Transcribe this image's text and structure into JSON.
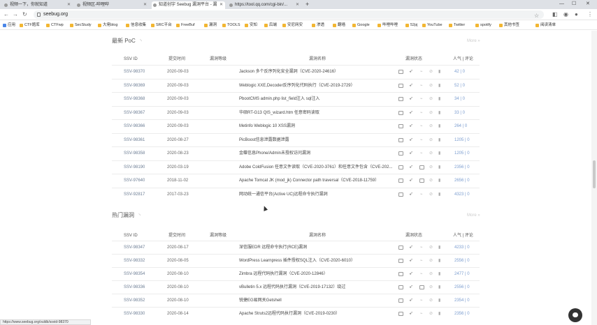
{
  "browser": {
    "tabs": [
      {
        "label": "视频一下，你就知道"
      },
      {
        "label": "视频区-哔哩哔"
      },
      {
        "label": "知道创宇 Seebug 漏洞平台 - 漏"
      },
      {
        "label": "https://tool.qq.com/cgi-bin/..."
      }
    ],
    "url": "seebug.org",
    "status_url": "https://www.seebug.org/vuldb/ssvid-98370"
  },
  "bookmarks": [
    {
      "label": "应用"
    },
    {
      "label": "CTF题库"
    },
    {
      "label": "CTFwp"
    },
    {
      "label": "SecStudy"
    },
    {
      "label": "大佬blog"
    },
    {
      "label": "信息收集"
    },
    {
      "label": "SRC平台"
    },
    {
      "label": "FreeBuf"
    },
    {
      "label": "漏洞"
    },
    {
      "label": "TOOLS"
    },
    {
      "label": "安知"
    },
    {
      "label": "后端"
    },
    {
      "label": "安尼网安"
    },
    {
      "label": "渗透"
    },
    {
      "label": "翻墙"
    },
    {
      "label": "Google"
    },
    {
      "label": "哔哩哔哩"
    },
    {
      "label": "52pj"
    },
    {
      "label": "YouTube"
    },
    {
      "label": "Twitter"
    },
    {
      "label": "spotify"
    },
    {
      "label": "其他书签"
    },
    {
      "label": "阅读清单"
    }
  ],
  "latest": {
    "title": "最新 PoC",
    "more": "More »",
    "headers": {
      "id": "SSV ID",
      "date": "提交时间",
      "level": "漏洞等级",
      "name": "漏洞名称",
      "status": "漏洞状态",
      "pop": "人气 | 评论"
    },
    "rows": [
      {
        "id": "SSV-98370",
        "date": "2020-09-03",
        "level": 3,
        "name": "Jackson 多个反序列化安全漏洞（CVE-2020-24616）",
        "pop": "42 | 0",
        "docs": false
      },
      {
        "id": "SSV-98369",
        "date": "2020-09-03",
        "level": 3,
        "name": "Weblogic XXE,Decoder反序列化代码执行（CVE-2019-2729）",
        "pop": "52 | 0",
        "docs": false
      },
      {
        "id": "SSV-98368",
        "date": "2020-09-03",
        "level": 3,
        "name": "PbootCMS admin.php list_field注入 sql注入",
        "pop": "34 | 0",
        "docs": false
      },
      {
        "id": "SSV-98367",
        "date": "2020-09-03",
        "level": 3,
        "name": "华硕RT-G13 QIS_wizard.htm 任意密码读取",
        "pop": "33 | 0",
        "docs": false
      },
      {
        "id": "SSV-98366",
        "date": "2020-09-03",
        "level": 3,
        "name": "Metinfo Weblogic 10 XSS漏洞",
        "pop": "264 | 0",
        "docs": false
      },
      {
        "id": "SSV-98361",
        "date": "2020-08-27",
        "level": 3,
        "name": "PicBoost信息泄露数据泄露",
        "pop": "1205 | 0",
        "docs": false
      },
      {
        "id": "SSV-98358",
        "date": "2020-08-23",
        "level": 3,
        "name": "金蝶信息Phone/Admin未授权访问漏洞",
        "pop": "1205 | 0",
        "docs": false
      },
      {
        "id": "SSV-98190",
        "date": "2020-03-19",
        "level": 3,
        "name": "Adobe ColdFusion 任意文件读取（CVE-2020-3761）和任意文件包含（CVE-202...",
        "pop": "2356 | 0",
        "docs": true
      },
      {
        "id": "SSV-97640",
        "date": "2018-11-02",
        "level": 3,
        "name": "Apache Tomcat JK (mod_jk) Connector path traversal（CVE-2018-11759）",
        "pop": "2656 | 0",
        "docs": true
      },
      {
        "id": "SSV-92817",
        "date": "2017-03-23",
        "level": 3,
        "name": "网动统一通信平台(Active UC)远程命令执行漏洞",
        "pop": "4323 | 0",
        "docs": false
      }
    ]
  },
  "hot": {
    "title": "热门漏洞",
    "more": "More »",
    "headers": {
      "id": "SSV ID",
      "date": "提交时间",
      "level": "漏洞等级",
      "name": "漏洞名称",
      "status": "漏洞状态",
      "pop": "人气 | 评论"
    },
    "rows": [
      {
        "id": "SSV-98347",
        "date": "2020-08-17",
        "level": 3,
        "name": "深信服EDR 远程命令执行(RCE)漏洞",
        "pop": "4233 | 0",
        "docs": false
      },
      {
        "id": "SSV-98332",
        "date": "2020-08-05",
        "level": 3,
        "name": "WordPress Learnpress 插件授权SQL注入（CVE-2020-6010）",
        "pop": "2556 | 0",
        "docs": false
      },
      {
        "id": "SSV-98354",
        "date": "2020-08-10",
        "level": 3,
        "name": "Zimbra 远程代码执行漏洞（CVE-2020-12846）",
        "pop": "2477 | 0",
        "docs": false
      },
      {
        "id": "SSV-98336",
        "date": "2020-08-10",
        "level": 3,
        "name": "vBulletin 5.x 远程代码执行漏洞（CVE-2019-17132）绕过",
        "pop": "2556 | 0",
        "docs": true
      },
      {
        "id": "SSV-98352",
        "date": "2020-08-10",
        "level": 3,
        "name": "锐捷EG易网关Getshell",
        "pop": "2354 | 0",
        "docs": false
      },
      {
        "id": "SSV-98330",
        "date": "2020-08-14",
        "level": 3,
        "name": "Apache Struts2远程代码执行漏洞（CVE-2019-0230）",
        "pop": "2356 | 0",
        "docs": false
      }
    ]
  }
}
